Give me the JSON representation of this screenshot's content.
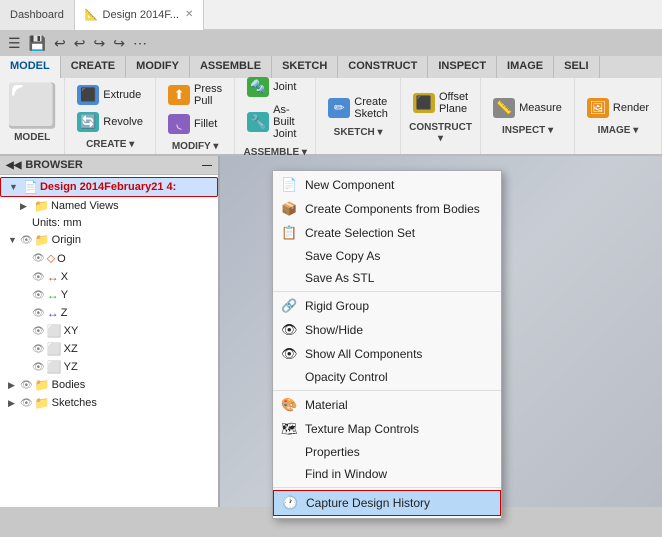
{
  "tabs": [
    {
      "id": "dashboard",
      "label": "Dashboard",
      "active": false,
      "icon": ""
    },
    {
      "id": "design",
      "label": "Design 2014F...",
      "active": true,
      "icon": "📐"
    }
  ],
  "toolbar": {
    "buttons": [
      "☰",
      "💾",
      "↩",
      "↩",
      "↪",
      "↪",
      "⋯"
    ]
  },
  "ribbon": {
    "tabs": [
      "MODEL",
      "CREATE",
      "MODIFY",
      "ASSEMBLE",
      "SKETCH",
      "CONSTRUCT",
      "INSPECT",
      "IMAGE",
      "SELI"
    ],
    "active_tab": "MODEL",
    "groups": [
      {
        "id": "model",
        "icon": "📦",
        "label": "MODEL"
      },
      {
        "id": "create",
        "icon": "⬛",
        "label": "CREATE"
      },
      {
        "id": "modify",
        "icon": "🔧",
        "label": "MODIFY"
      },
      {
        "id": "assemble",
        "icon": "🔩",
        "label": "ASSEMBLE"
      },
      {
        "id": "sketch",
        "icon": "✏️",
        "label": "SKETCH"
      },
      {
        "id": "construct",
        "icon": "🔨",
        "label": "CONSTRUCT"
      },
      {
        "id": "inspect",
        "icon": "📏",
        "label": "INSPECT"
      },
      {
        "id": "image",
        "icon": "🖼",
        "label": "IMAGE"
      }
    ]
  },
  "browser": {
    "header": "BROWSER",
    "items": [
      {
        "id": "root",
        "label": "Design 2014February21 4:",
        "level": 0,
        "selected": true,
        "bold": true,
        "icon": "doc",
        "toggle": "▼"
      },
      {
        "id": "named-views",
        "label": "Named Views",
        "level": 1,
        "icon": "folder",
        "toggle": "▶"
      },
      {
        "id": "units",
        "label": "Units: mm",
        "level": 1,
        "icon": "",
        "toggle": ""
      },
      {
        "id": "origin",
        "label": "Origin",
        "level": 1,
        "icon": "origin",
        "toggle": "▼"
      },
      {
        "id": "o",
        "label": "O",
        "level": 2,
        "icon": "dot",
        "toggle": ""
      },
      {
        "id": "x",
        "label": "X",
        "level": 2,
        "icon": "axis-r",
        "toggle": ""
      },
      {
        "id": "y",
        "label": "Y",
        "level": 2,
        "icon": "axis-g",
        "toggle": ""
      },
      {
        "id": "z",
        "label": "Z",
        "level": 2,
        "icon": "axis-b",
        "toggle": ""
      },
      {
        "id": "xy",
        "label": "XY",
        "level": 2,
        "icon": "plane-o",
        "toggle": ""
      },
      {
        "id": "xz",
        "label": "XZ",
        "level": 2,
        "icon": "plane-r",
        "toggle": ""
      },
      {
        "id": "yz",
        "label": "YZ",
        "level": 2,
        "icon": "plane-b",
        "toggle": ""
      },
      {
        "id": "bodies",
        "label": "Bodies",
        "level": 1,
        "icon": "folder",
        "toggle": "▶"
      },
      {
        "id": "sketches",
        "label": "Sketches",
        "level": 1,
        "icon": "folder",
        "toggle": "▶"
      }
    ]
  },
  "context_menu": {
    "items": [
      {
        "id": "new-component",
        "label": "New Component",
        "icon": "📄",
        "separator_after": false
      },
      {
        "id": "create-components",
        "label": "Create Components from Bodies",
        "icon": "📦",
        "separator_after": false
      },
      {
        "id": "create-selection-set",
        "label": "Create Selection Set",
        "icon": "📋",
        "separator_after": false
      },
      {
        "id": "save-copy-as",
        "label": "Save Copy As",
        "icon": "",
        "separator_after": false
      },
      {
        "id": "save-as-stl",
        "label": "Save As STL",
        "icon": "",
        "separator_after": true
      },
      {
        "id": "rigid-group",
        "label": "Rigid Group",
        "icon": "🔗",
        "separator_after": false
      },
      {
        "id": "show-hide",
        "label": "Show/Hide",
        "icon": "👁",
        "separator_after": false
      },
      {
        "id": "show-all",
        "label": "Show All Components",
        "icon": "👁",
        "separator_after": false
      },
      {
        "id": "opacity",
        "label": "Opacity Control",
        "icon": "",
        "separator_after": true
      },
      {
        "id": "material",
        "label": "Material",
        "icon": "🎨",
        "separator_after": false
      },
      {
        "id": "texture-map",
        "label": "Texture Map Controls",
        "icon": "🗺",
        "separator_after": false
      },
      {
        "id": "properties",
        "label": "Properties",
        "icon": "",
        "separator_after": false
      },
      {
        "id": "find-window",
        "label": "Find in Window",
        "icon": "",
        "separator_after": true
      },
      {
        "id": "capture-history",
        "label": "Capture Design History",
        "icon": "🕐",
        "highlighted": true,
        "separator_after": false
      }
    ]
  }
}
